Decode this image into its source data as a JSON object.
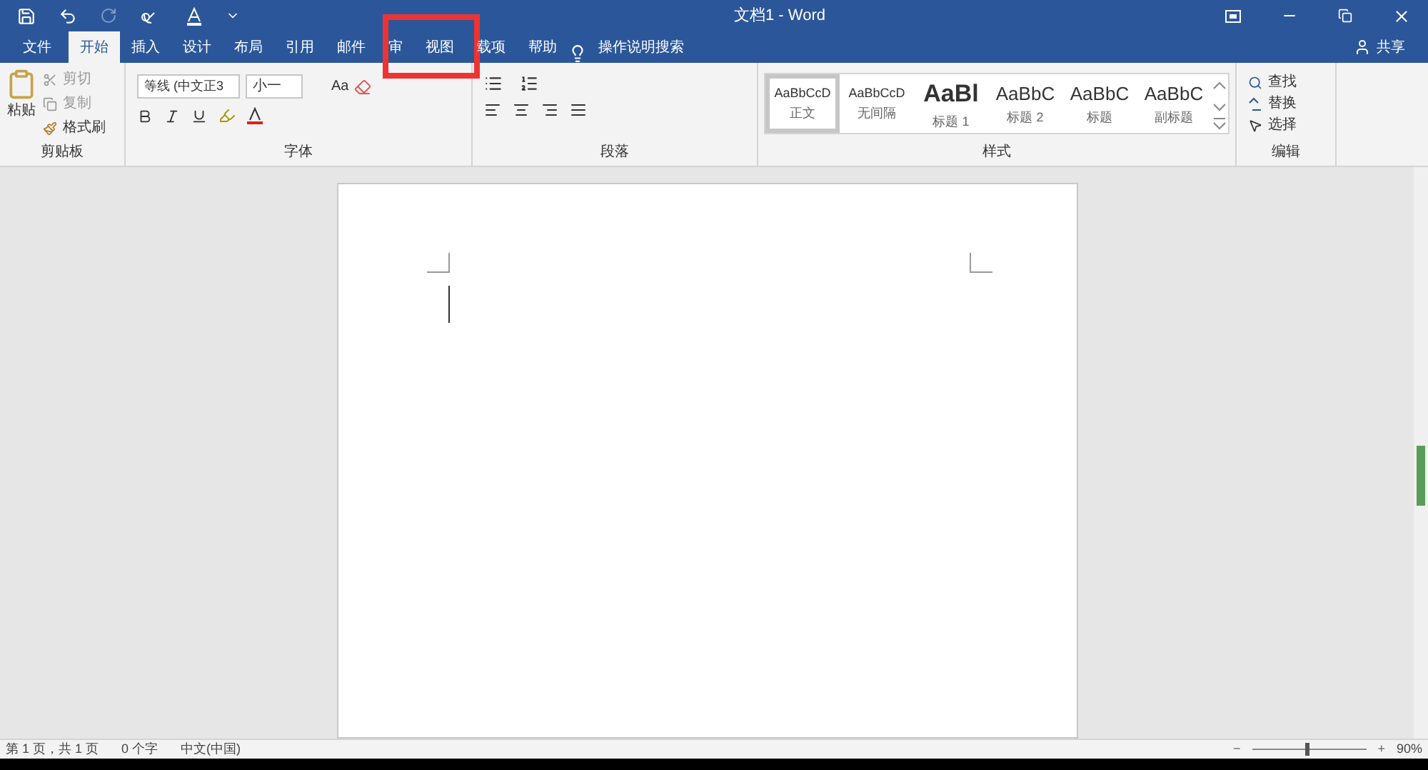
{
  "window": {
    "title": "文档1  -  Word"
  },
  "tabs": [
    {
      "label": "文件",
      "selected": false
    },
    {
      "label": "开始",
      "selected": true
    },
    {
      "label": "插入",
      "selected": false
    },
    {
      "label": "设计",
      "selected": false
    },
    {
      "label": "布局",
      "selected": false
    },
    {
      "label": "引用",
      "selected": false
    },
    {
      "label": "邮件",
      "selected": false
    },
    {
      "label": "审",
      "selected": false
    },
    {
      "label": "视图",
      "selected": false,
      "highlighted": true
    },
    {
      "label": "载项",
      "selected": false
    },
    {
      "label": "帮助",
      "selected": false
    }
  ],
  "tell_me": "操作说明搜索",
  "share": "共享",
  "clipboard": {
    "paste": "粘贴",
    "cut": "剪切",
    "copy": "复制",
    "format_painter": "格式刷",
    "group": "剪贴板"
  },
  "font": {
    "name": "等线 (中文正3",
    "size": "小一",
    "case": "Aa",
    "group": "字体"
  },
  "paragraph": {
    "group": "段落"
  },
  "styles": {
    "group": "样式",
    "items": [
      {
        "preview": "AaBbCcD",
        "label": "正文",
        "selected": true,
        "kind": "small"
      },
      {
        "preview": "AaBbCcD",
        "label": "无间隔",
        "selected": false,
        "kind": "small"
      },
      {
        "preview": "AaBl",
        "label": "标题 1",
        "selected": false,
        "kind": "h1"
      },
      {
        "preview": "AaBbC",
        "label": "标题 2",
        "selected": false,
        "kind": "h2"
      },
      {
        "preview": "AaBbC",
        "label": "标题",
        "selected": false,
        "kind": "h2"
      },
      {
        "preview": "AaBbC",
        "label": "副标题",
        "selected": false,
        "kind": "h2"
      }
    ]
  },
  "editing": {
    "find": "查找",
    "replace": "替换",
    "select": "选择",
    "group": "编辑"
  },
  "status_bar": {
    "page": "第 1 页，共 1 页",
    "words": "0 个字",
    "language": "中文(中国)",
    "zoom": "90%",
    "zoom_out": "−",
    "zoom_in": "+",
    "zoom_slider": {
      "level": 0.46
    }
  }
}
